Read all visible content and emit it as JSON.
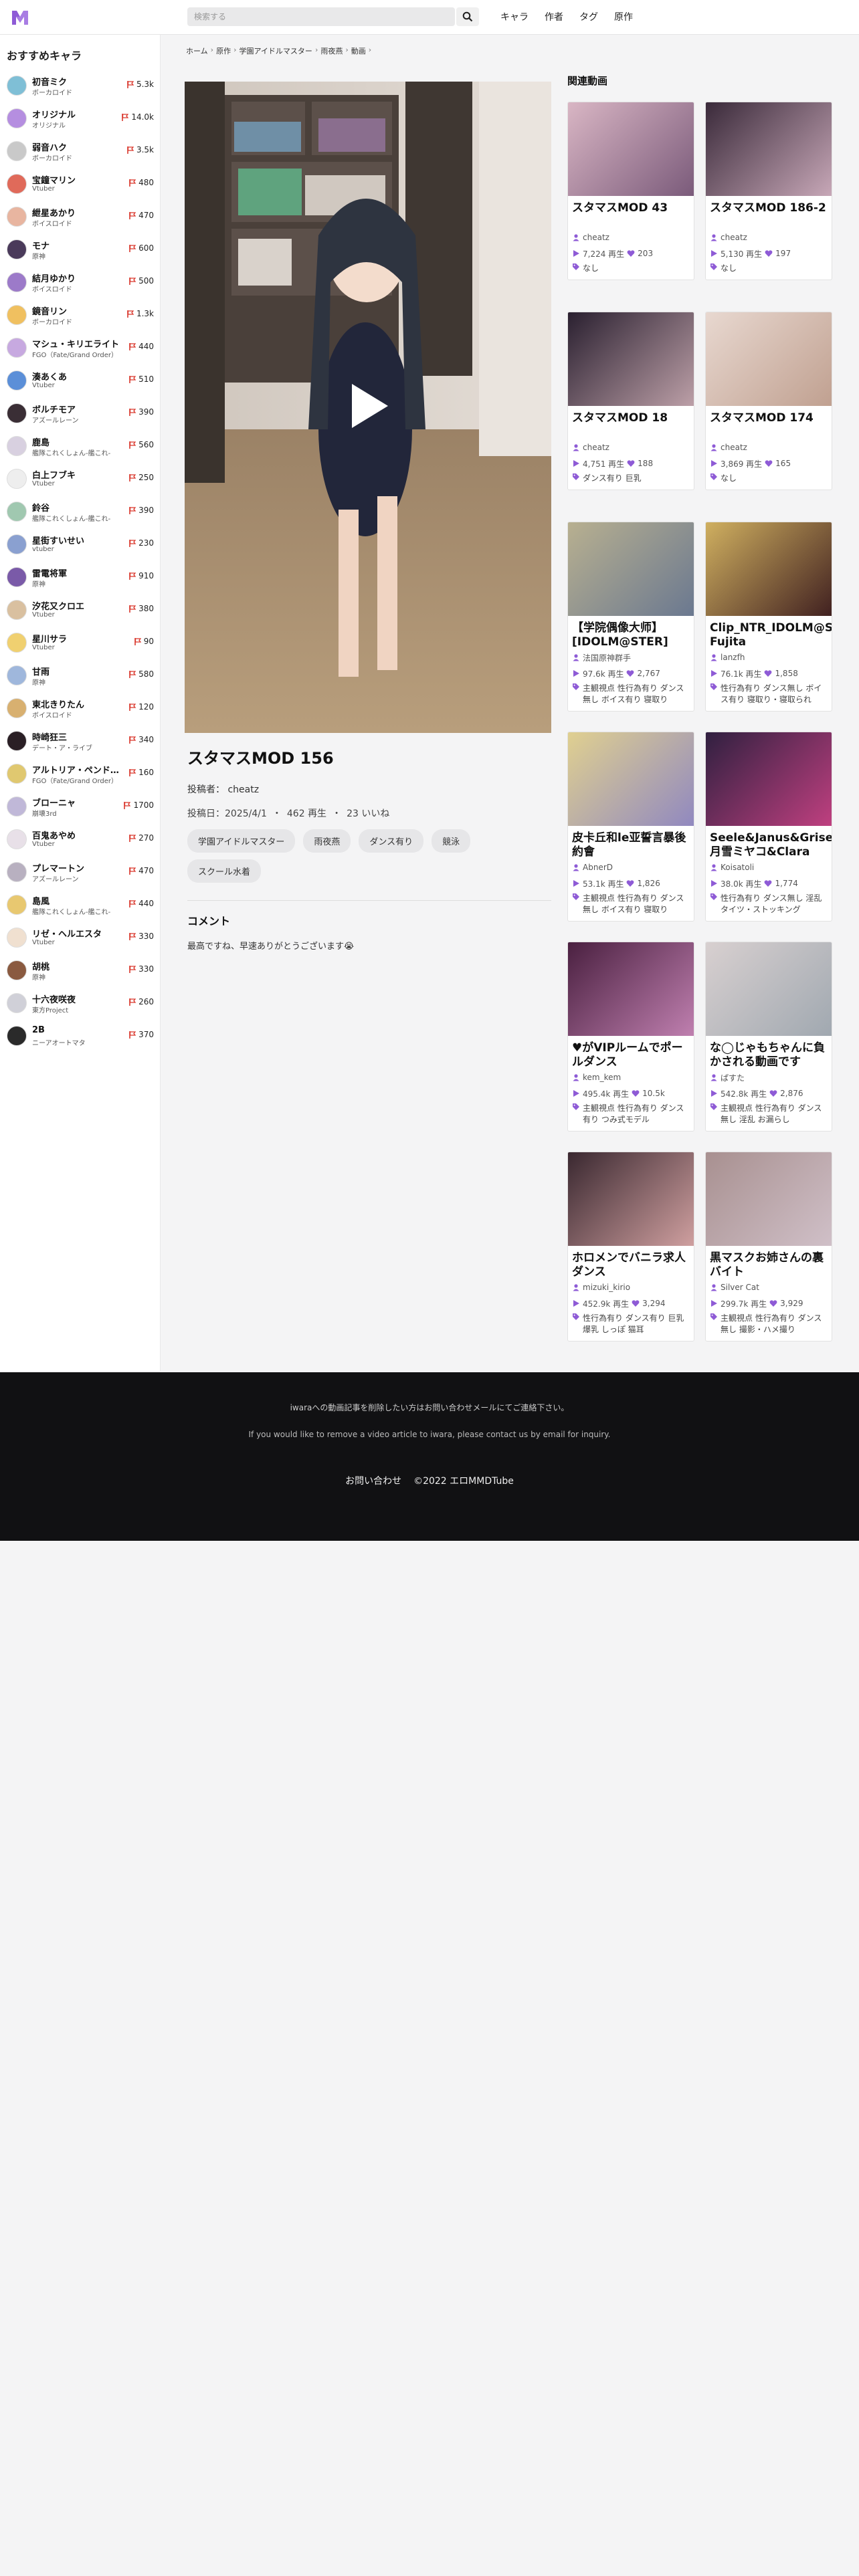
{
  "header": {
    "search_placeholder": "検索する",
    "nav": [
      "キャラ",
      "作者",
      "タグ",
      "原作"
    ],
    "brand_color": "#8e5bd6"
  },
  "sidebar": {
    "title": "おすすめキャラ",
    "items": [
      {
        "name": "初音ミク",
        "sub": "ボーカロイド",
        "count": "5.3k"
      },
      {
        "name": "オリジナル",
        "sub": "オリジナル",
        "count": "14.0k"
      },
      {
        "name": "弱音ハク",
        "sub": "ボーカロイド",
        "count": "3.5k"
      },
      {
        "name": "宝鐘マリン",
        "sub": "Vtuber",
        "count": "480"
      },
      {
        "name": "紲星あかり",
        "sub": "ボイスロイド",
        "count": "470"
      },
      {
        "name": "モナ",
        "sub": "原神",
        "count": "600"
      },
      {
        "name": "結月ゆかり",
        "sub": "ボイスロイド",
        "count": "500"
      },
      {
        "name": "鏡音リン",
        "sub": "ボーカロイド",
        "count": "1.3k"
      },
      {
        "name": "マシュ・キリエライト",
        "sub": "FGO（Fate/Grand Order）",
        "count": "440"
      },
      {
        "name": "湊あくあ",
        "sub": "Vtuber",
        "count": "510"
      },
      {
        "name": "ボルチモア",
        "sub": "アズールレーン",
        "count": "390"
      },
      {
        "name": "鹿島",
        "sub": "艦隊これくしょん-艦これ-",
        "count": "560"
      },
      {
        "name": "白上フブキ",
        "sub": "Vtuber",
        "count": "250"
      },
      {
        "name": "鈴谷",
        "sub": "艦隊これくしょん-艦これ-",
        "count": "390"
      },
      {
        "name": "星街すいせい",
        "sub": "vtuber",
        "count": "230"
      },
      {
        "name": "雷電将軍",
        "sub": "原神",
        "count": "910"
      },
      {
        "name": "汐花又クロエ",
        "sub": "Vtuber",
        "count": "380"
      },
      {
        "name": "星川サラ",
        "sub": "Vtuber",
        "count": "90"
      },
      {
        "name": "甘雨",
        "sub": "原神",
        "count": "580"
      },
      {
        "name": "東北きりたん",
        "sub": "ボイスロイド",
        "count": "120"
      },
      {
        "name": "時崎狂三",
        "sub": "デート・ア・ライブ",
        "count": "340"
      },
      {
        "name": "アルトリア・ペンドラゴン",
        "sub": "FGO（Fate/Grand Order）",
        "count": "160"
      },
      {
        "name": "ブローニャ",
        "sub": "崩壊3rd",
        "count": "1700"
      },
      {
        "name": "百鬼あやめ",
        "sub": "Vtuber",
        "count": "270"
      },
      {
        "name": "プレマートン",
        "sub": "アズールレーン",
        "count": "470"
      },
      {
        "name": "島風",
        "sub": "艦隊これくしょん-艦これ-",
        "count": "440"
      },
      {
        "name": "リゼ・ヘルエスタ",
        "sub": "Vtuber",
        "count": "330"
      },
      {
        "name": "胡桃",
        "sub": "原神",
        "count": "330"
      },
      {
        "name": "十六夜咲夜",
        "sub": "東方Project",
        "count": "260"
      },
      {
        "name": "2B",
        "sub": "ニーアオートマタ",
        "count": "370"
      }
    ]
  },
  "breadcrumb": [
    "ホーム",
    "原作",
    "学園アイドルマスター",
    "雨夜燕",
    "動画"
  ],
  "video": {
    "title": "スタマスMOD 156",
    "poster_label": "投稿者：",
    "poster": "cheatz",
    "date_label": "投稿日：2025/4/1",
    "views": "462 再生",
    "likes": "23 いいね",
    "tags": [
      "学園アイドルマスター",
      "雨夜燕",
      "ダンス有り",
      "競泳",
      "スクール水着"
    ]
  },
  "comments": {
    "heading": "コメント",
    "text": "最高ですね、早速ありがとうございます😭"
  },
  "related": {
    "heading": "関連動画",
    "items": [
      {
        "title": "スタマスMOD 43",
        "author": "cheatz",
        "views": "7,224 再生",
        "likes": "203",
        "tags": "なし"
      },
      {
        "title": "スタマスMOD 186-2",
        "author": "cheatz",
        "views": "5,130 再生",
        "likes": "197",
        "tags": "なし"
      },
      {
        "title": "スタマスMOD 18",
        "author": "cheatz",
        "views": "4,751 再生",
        "likes": "188",
        "tags": "ダンス有り 巨乳"
      },
      {
        "title": "スタマスMOD 174",
        "author": "cheatz",
        "views": "3,869 再生",
        "likes": "165",
        "tags": "なし"
      },
      {
        "title": "【学院偶像大师】[IDOLM@STER]【QOO】",
        "author": "法国原神群手",
        "views": "97.6k 再生",
        "likes": "2,767",
        "tags": "主観視点 性行為有り ダンス無し ボイス有り 寝取り"
      },
      {
        "title": "Clip_NTR_IDOLM@STER_Kotone Fujita",
        "author": "lanzfh",
        "views": "76.1k 再生",
        "likes": "1,858",
        "tags": "性行為有り ダンス無し ボイス有り 寝取り・寝取られ"
      },
      {
        "title": "皮卡丘和le亚誓言暴後約會",
        "author": "AbnerD",
        "views": "53.1k 再生",
        "likes": "1,826",
        "tags": "主観視点 性行為有り ダンス無し ボイス有り 寝取り"
      },
      {
        "title": "Seele&Janus&Griseo&月雪ミヤコ&Clara",
        "author": "Koisatoli",
        "views": "38.0k 再生",
        "likes": "1,774",
        "tags": "性行為有り ダンス無し 淫乱 タイツ・ストッキング"
      },
      {
        "title": "♥がVIPルームでポールダンス",
        "author": "kem_kem",
        "views": "495.4k 再生",
        "likes": "10.5k",
        "tags": "主観視点 性行為有り ダンス有り つみ式モデル"
      },
      {
        "title": "な◯じゃもちゃんに負かされる動画です",
        "author": "ぱすた",
        "views": "542.8k 再生",
        "likes": "2,876",
        "tags": "主観視点 性行為有り ダンス無し 淫乱 お漏らし"
      },
      {
        "title": "ホロメンでバニラ求人ダンス",
        "author": "mizuki_kirio",
        "views": "452.9k 再生",
        "likes": "3,294",
        "tags": "性行為有り ダンス有り 巨乳 爆乳 しっぽ 猫耳"
      },
      {
        "title": "黒マスクお姉さんの裏バイト",
        "author": "Silver Cat",
        "views": "299.7k 再生",
        "likes": "3,929",
        "tags": "主観視点 性行為有り ダンス無し 撮影・ハメ撮り"
      }
    ]
  },
  "footer": {
    "line1": "iwaraへの動画記事を削除したい方はお問い合わせメールにてご連絡下さい。",
    "line2": "If you would like to remove a video article to iwara, please contact us by email for inquiry.",
    "contact": "お問い合わせ",
    "copyright": "©2022 エロMMDTube"
  }
}
